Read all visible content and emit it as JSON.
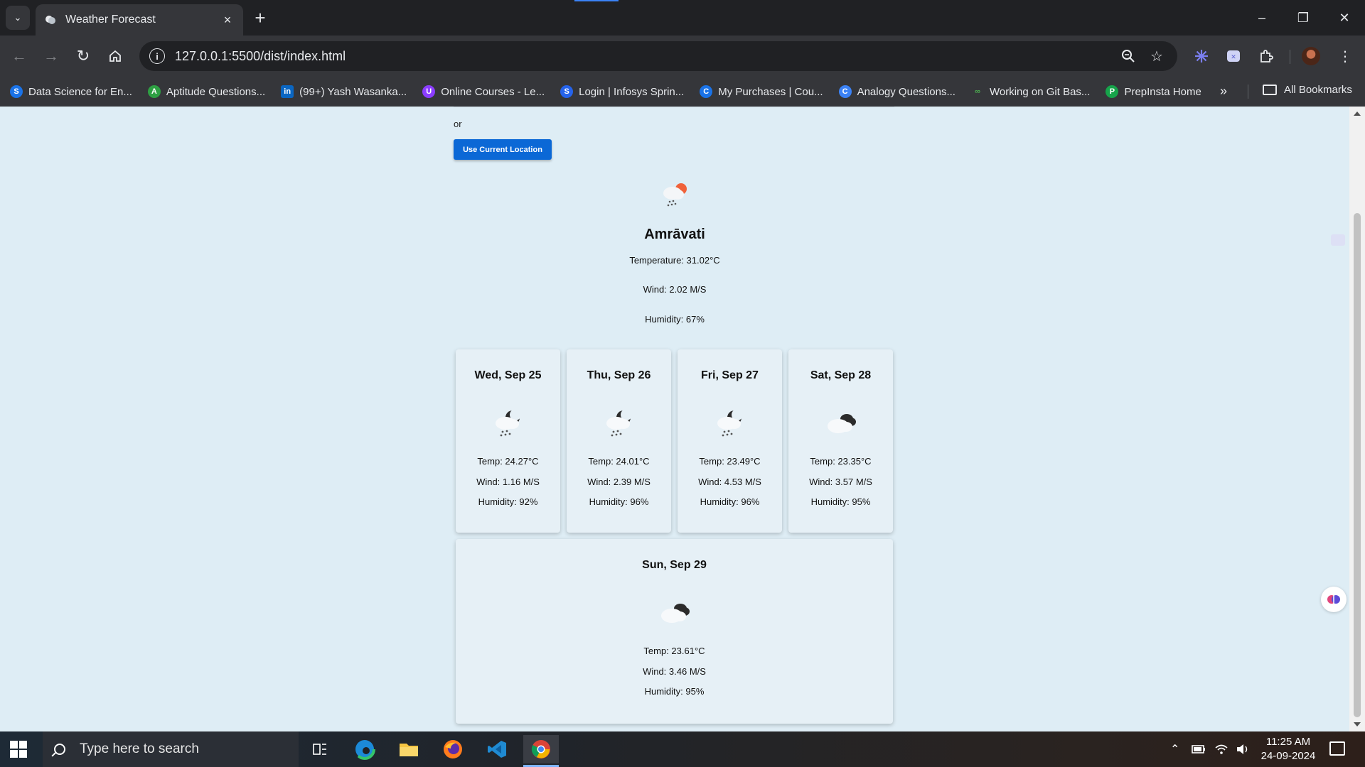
{
  "browser": {
    "tab_title": "Weather Forecast",
    "tab_close": "×",
    "new_tab": "+",
    "url": "127.0.0.1:5500/dist/index.html",
    "window_controls": {
      "minimize": "–",
      "maximize": "❐",
      "close": "✕"
    },
    "bookmarks": [
      {
        "label": "Data Science for En...",
        "icon": "S",
        "color": "#1a73e8"
      },
      {
        "label": "Aptitude Questions...",
        "icon": "A",
        "color": "#2ea043"
      },
      {
        "label": "(99+) Yash Wasanka...",
        "icon": "in",
        "color": "#0a66c2"
      },
      {
        "label": "Online Courses - Le...",
        "icon": "U",
        "color": "#8b3dff"
      },
      {
        "label": "Login | Infosys Sprin...",
        "icon": "S",
        "color": "#2563eb"
      },
      {
        "label": "My Purchases | Cou...",
        "icon": "C",
        "color": "#1a73e8"
      },
      {
        "label": "Analogy Questions...",
        "icon": "C",
        "color": "#3b82f6"
      },
      {
        "label": "Working on Git Bas...",
        "icon": "∞",
        "color": "#2e7d32"
      },
      {
        "label": "PrepInsta Home",
        "icon": "P",
        "color": "#16a34a"
      }
    ],
    "bookmarks_overflow": "»",
    "all_bookmarks": "All Bookmarks"
  },
  "page": {
    "or_text": "or",
    "location_button": "Use Current Location",
    "current": {
      "city": "Amrāvati",
      "temperature": "Temperature: 31.02°C",
      "wind": "Wind: 2.02 M/S",
      "humidity": "Humidity: 67%",
      "icon": "rain-sun-icon"
    },
    "forecast": [
      {
        "day": "Wed, Sep 25",
        "temp": "Temp: 24.27°C",
        "wind": "Wind: 1.16 M/S",
        "humidity": "Humidity: 92%",
        "icon": "rain-night-icon"
      },
      {
        "day": "Thu, Sep 26",
        "temp": "Temp: 24.01°C",
        "wind": "Wind: 2.39 M/S",
        "humidity": "Humidity: 96%",
        "icon": "rain-night-icon"
      },
      {
        "day": "Fri, Sep 27",
        "temp": "Temp: 23.49°C",
        "wind": "Wind: 4.53 M/S",
        "humidity": "Humidity: 96%",
        "icon": "rain-night-icon"
      },
      {
        "day": "Sat, Sep 28",
        "temp": "Temp: 23.35°C",
        "wind": "Wind: 3.57 M/S",
        "humidity": "Humidity: 95%",
        "icon": "cloudy-night-icon"
      },
      {
        "day": "Sun, Sep 29",
        "temp": "Temp: 23.61°C",
        "wind": "Wind: 3.46 M/S",
        "humidity": "Humidity: 95%",
        "icon": "cloudy-night-icon"
      }
    ]
  },
  "taskbar": {
    "search_placeholder": "Type here to search",
    "time": "11:25 AM",
    "date": "24-09-2024"
  }
}
